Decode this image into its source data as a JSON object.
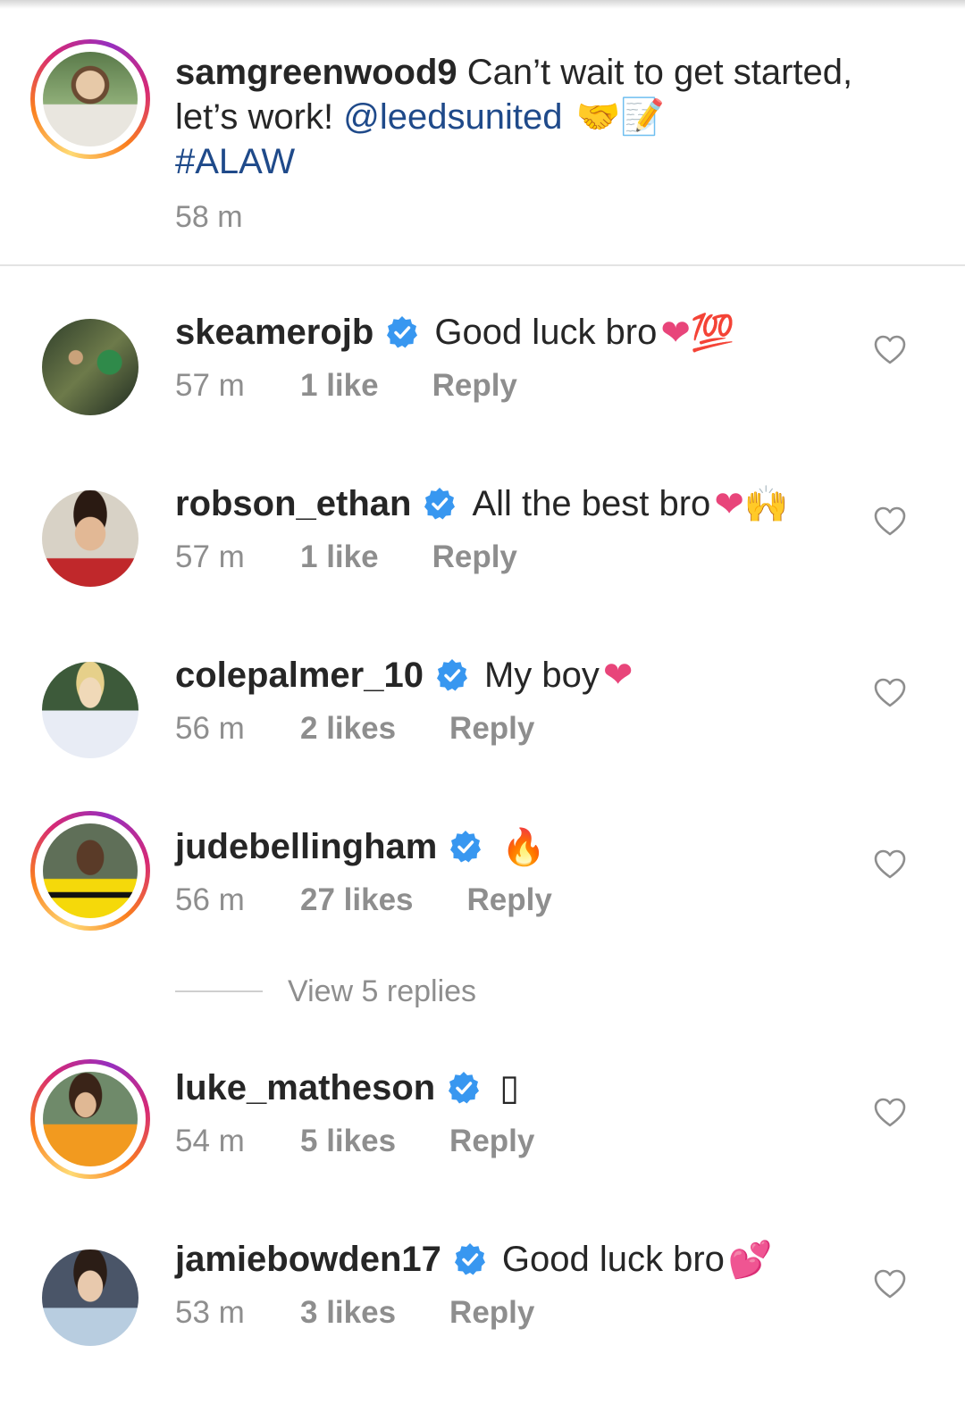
{
  "caption": {
    "username": "samgreenwood9",
    "text": "Can’t wait to get started, let’s work!",
    "mention": "@leedsunited",
    "emojis": "🤝📝",
    "hashtag": "#ALAW",
    "time": "58 m"
  },
  "comments": [
    {
      "username": "skeamerojb",
      "text": "Good luck bro",
      "emojis": "❤💯",
      "time": "57 m",
      "likes": "1 like",
      "reply": "Reply"
    },
    {
      "username": "robson_ethan",
      "text": "All the best bro",
      "emojis": "❤🙌",
      "time": "57 m",
      "likes": "1 like",
      "reply": "Reply"
    },
    {
      "username": "colepalmer_10",
      "text": "My boy",
      "emojis": "❤",
      "time": "56 m",
      "likes": "2 likes",
      "reply": "Reply"
    },
    {
      "username": "judebellingham",
      "text": "",
      "emojis": "🔥",
      "time": "56 m",
      "likes": "27 likes",
      "reply": "Reply"
    },
    {
      "username": "luke_matheson",
      "text": "",
      "emojis": "▯",
      "time": "54 m",
      "likes": "5 likes",
      "reply": "Reply"
    },
    {
      "username": "jamiebowden17",
      "text": "Good luck bro",
      "emojis": "💕",
      "time": "53 m",
      "likes": "3 likes",
      "reply": "Reply"
    }
  ],
  "view_replies": "View 5 replies",
  "colors": {
    "verified": "#3897f0",
    "link": "#1f4a8a",
    "secondary_text": "#8e8e8e",
    "heart_emoji": "#e8457a"
  },
  "icons": {
    "verified": "verified-badge-icon",
    "like": "heart-outline-icon"
  }
}
